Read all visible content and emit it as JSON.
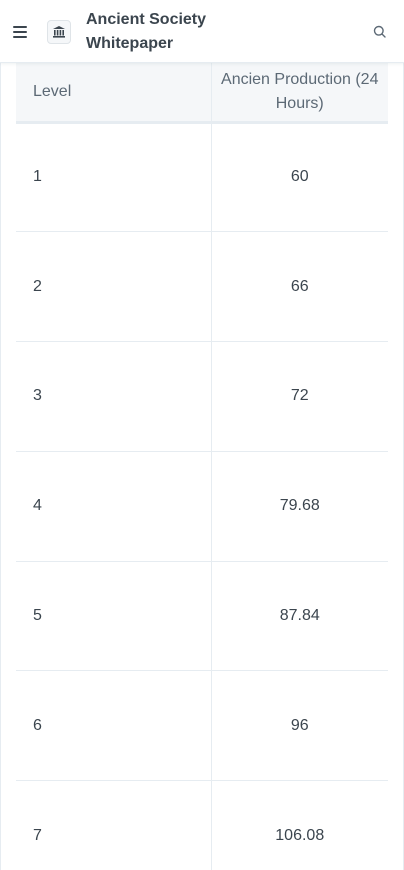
{
  "header": {
    "title_line1": "Ancient Society",
    "title_line2": "Whitepaper",
    "menu_icon": "hamburger-menu-icon",
    "logo_icon": "museum-icon",
    "search_icon": "search-icon"
  },
  "table": {
    "columns": [
      "Level",
      "Ancien Production (24 Hours)"
    ],
    "rows": [
      {
        "level": "1",
        "production": "60"
      },
      {
        "level": "2",
        "production": "66"
      },
      {
        "level": "3",
        "production": "72"
      },
      {
        "level": "4",
        "production": "79.68"
      },
      {
        "level": "5",
        "production": "87.84"
      },
      {
        "level": "6",
        "production": "96"
      },
      {
        "level": "7",
        "production": "106.08"
      }
    ]
  }
}
